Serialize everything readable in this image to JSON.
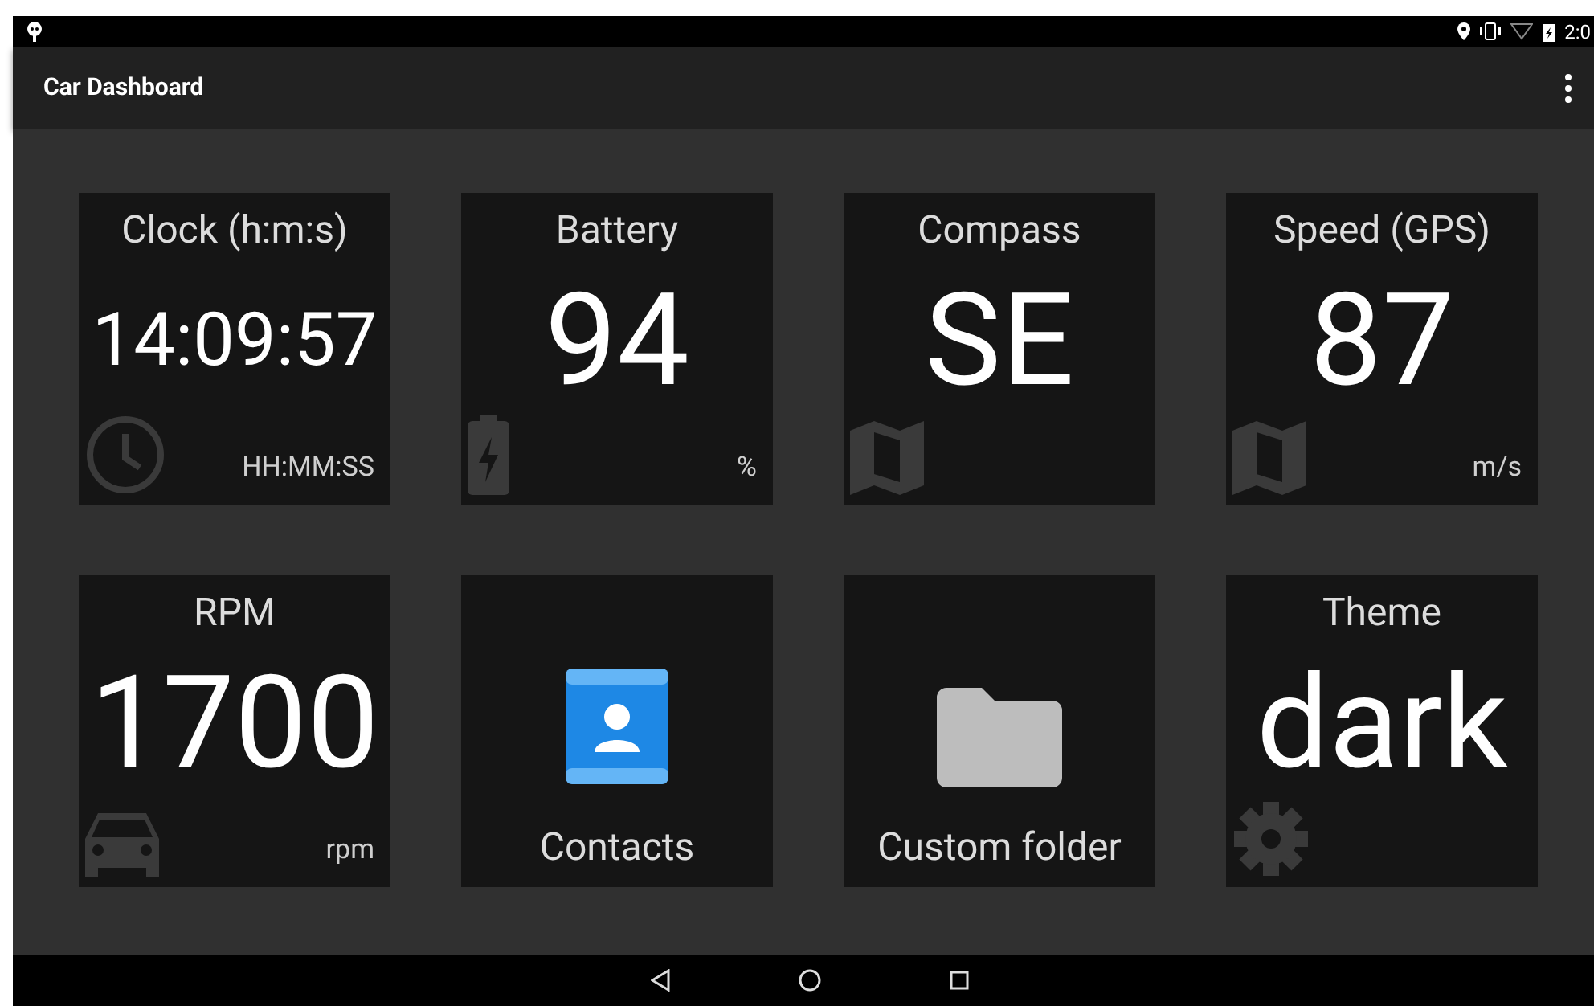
{
  "status_bar": {
    "time": "2:0"
  },
  "app_bar": {
    "title": "Car Dashboard"
  },
  "tiles": [
    {
      "kind": "value",
      "title": "Clock (h:m:s)",
      "value": "14:09:57",
      "unit": "HH:MM:SS"
    },
    {
      "kind": "value",
      "title": "Battery",
      "value": "94",
      "unit": "%"
    },
    {
      "kind": "value",
      "title": "Compass",
      "value": "SE"
    },
    {
      "kind": "value",
      "title": "Speed (GPS)",
      "value": "87",
      "unit": "m/s"
    },
    {
      "kind": "value",
      "title": "RPM",
      "value": "1700",
      "unit": "rpm"
    },
    {
      "kind": "shortcut",
      "label": "Contacts"
    },
    {
      "kind": "shortcut",
      "label": "Custom folder"
    },
    {
      "kind": "value",
      "title": "Theme",
      "value": "dark"
    }
  ]
}
